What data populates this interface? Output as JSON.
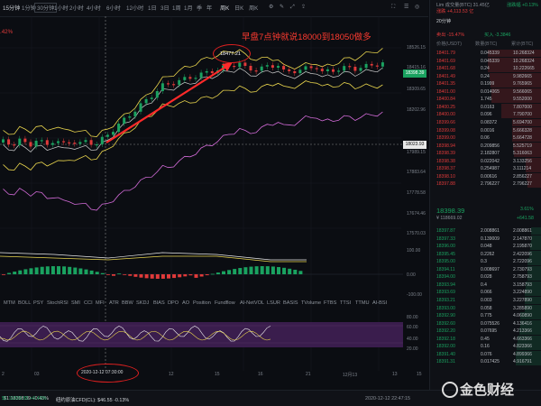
{
  "toolbar": {
    "timeframes": [
      "15分钟",
      "1分钟",
      "30分钟",
      "1小时",
      "2小时",
      "4小时",
      "6小时",
      "12小时",
      "1日",
      "3日",
      "1周",
      "1月",
      "季",
      "年"
    ],
    "active": "15分钟",
    "menu": [
      "周K",
      "日K",
      "周K"
    ],
    "annotation_label": "早盘7点钟就说18000到18050做多",
    "high_label": "18477.21",
    "top_pct": ".42%"
  },
  "price_axis": [
    "18526.15",
    "18415.16",
    "18309.65",
    "18202.96",
    "18023.93",
    "17989.15",
    "17883.64",
    "17778.58",
    "17674.46",
    "17570.03"
  ],
  "price_tags": {
    "current": "18398.39",
    "cross": "18023.93"
  },
  "macd_axis": [
    "100.00",
    "0.00",
    "-100.00"
  ],
  "osc_axis": [
    "80.00",
    "60.00",
    "40.00",
    "20.00"
  ],
  "indicators": [
    "MTM",
    "BOLL",
    "PSY",
    "StochRSI",
    "SMI",
    "CCI",
    "MFI",
    "ATR",
    "BBW",
    "SKDJ",
    "BIAS",
    "DPO",
    "AO",
    "Position",
    "Fundflow",
    "AI-NetVOL",
    "LSUR",
    "BASIS",
    "TVolume",
    "FTBS",
    "TTSI",
    "TTMU",
    "AI-BSI"
  ],
  "x_axis": [
    "2",
    "03",
    "",
    "",
    "12",
    "15",
    "16",
    "21",
    "12月13",
    "13",
    "15"
  ],
  "cross_date": "2020-12-12 07:30:00",
  "bottom": {
    "left": "$1 18398.39 +0.43%",
    "mid1": "$1 11839.85 +0.43%",
    "mid2": "纽约原油CFD(CL): $46.55 -0.13%",
    "right": "2020-12-12 22:47:15"
  },
  "right_panel": {
    "top1": "Lim 成交量(BTC) 31.45亿",
    "top2": "涨跌幅 +0.13%",
    "top3": "涨跌 +4,113.53 亿",
    "tab": "20分钟",
    "sell_pct": "卖出 -15.47%",
    "buy_pct": "买入 -3.3846",
    "hdr_price": "价格(USDT)",
    "hdr_amount": "数量(BTC)",
    "hdr_total": "累计(BTC)",
    "asks": [
      [
        "18401.79",
        "0.045339",
        "10.268324"
      ],
      [
        "18401.69",
        "0.045339",
        "10.268324"
      ],
      [
        "18401.68",
        "0.24",
        "10.222665"
      ],
      [
        "18401.49",
        "0.24",
        "9.982665"
      ],
      [
        "18401.35",
        "0.1999",
        "9.765965"
      ],
      [
        "18401.00",
        "0.014065",
        "9.566065"
      ],
      [
        "18400.84",
        "1.745",
        "9.552000"
      ],
      [
        "18400.25",
        "0.0163",
        "7.807000"
      ],
      [
        "18400.00",
        "0.096",
        "7.790700"
      ],
      [
        "18399.66",
        "0.08372",
        "5.694700"
      ],
      [
        "18399.08",
        "0.0016",
        "5.666328"
      ],
      [
        "18399.00",
        "0.06",
        "5.664728"
      ],
      [
        "18398.94",
        "0.209856",
        "5.525719"
      ],
      [
        "18398.39",
        "2.182807",
        "5.316063"
      ],
      [
        "18398.38",
        "0.022042",
        "3.133256"
      ],
      [
        "18398.37",
        "0.254987",
        "3.111214"
      ],
      [
        "18398.10",
        "0.00616",
        "2.856227"
      ],
      [
        "18397.88",
        "2.796227",
        "2.796227"
      ]
    ],
    "last_price": "18398.39",
    "last_cny": "¥ 118669.02",
    "change_pct": "3.61%",
    "change_abs": "+641.58",
    "bids": [
      [
        "18397.87",
        "2.008861",
        "2.008861"
      ],
      [
        "18397.33",
        "0.139009",
        "2.147870"
      ],
      [
        "18396.00",
        "0.048",
        "2.195870"
      ],
      [
        "18395.45",
        "0.2262",
        "2.422096"
      ],
      [
        "18395.00",
        "0.3",
        "2.722096"
      ],
      [
        "18394.11",
        "0.008697",
        "2.730793"
      ],
      [
        "18394.00",
        "0.028",
        "2.758793"
      ],
      [
        "18393.94",
        "0.4",
        "3.158793"
      ],
      [
        "18393.69",
        "0.066",
        "3.224890"
      ],
      [
        "18393.21",
        "0.003",
        "3.227890"
      ],
      [
        "18393.00",
        "0.058",
        "3.285890"
      ],
      [
        "18392.90",
        "0.775",
        "4.060890"
      ],
      [
        "18392.60",
        "0.075526",
        "4.136416"
      ],
      [
        "18392.20",
        "0.07695",
        "4.213366"
      ],
      [
        "18392.18",
        "0.45",
        "4.663366"
      ],
      [
        "18392.00",
        "0.16",
        "4.823366"
      ],
      [
        "18391.40",
        "0.076",
        "4.899366"
      ],
      [
        "18391.31",
        "0.017425",
        "4.916791"
      ]
    ]
  },
  "watermark": "金色财经",
  "colors": {
    "up": "#1aa260",
    "down": "#e03a3a",
    "annotation": "#ff3b30",
    "boll": "#e8d44d",
    "ma": "#d36bd8",
    "osc_bg": "#3a1d4d"
  }
}
